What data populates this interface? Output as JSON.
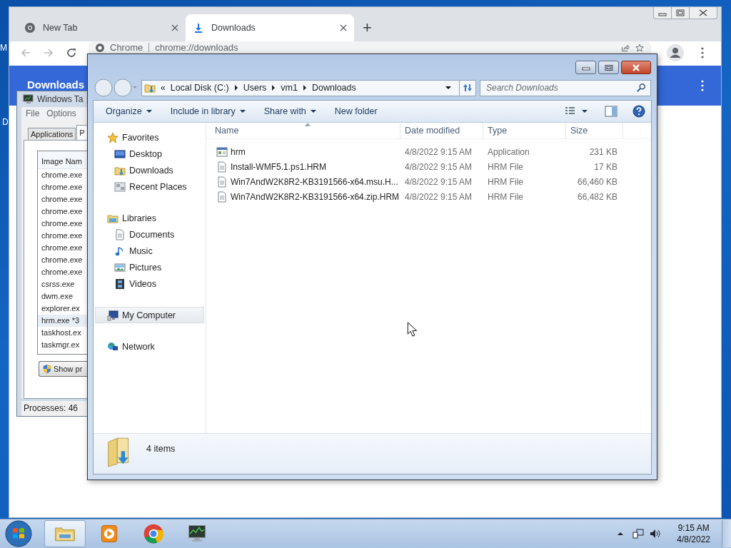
{
  "desktop": {
    "labels": [
      "M",
      "D"
    ]
  },
  "browser": {
    "tabs": [
      {
        "title": "New Tab",
        "selected": false
      },
      {
        "title": "Downloads",
        "selected": true
      }
    ],
    "new_tab": "+",
    "address": {
      "site": "Chrome",
      "url": "chrome://downloads"
    },
    "page": {
      "title": "Downloads"
    }
  },
  "task_manager": {
    "title": "Windows Ta",
    "menu": [
      "File",
      "Options"
    ],
    "tabs": [
      {
        "label": "Applications",
        "selected": false
      },
      {
        "label": "P",
        "selected": true
      }
    ],
    "column": "Image Nam",
    "rows": [
      {
        "name": "chrome.exe",
        "selected": false
      },
      {
        "name": "chrome.exe",
        "selected": false
      },
      {
        "name": "chrome.exe",
        "selected": false
      },
      {
        "name": "chrome.exe",
        "selected": false
      },
      {
        "name": "chrome.exe",
        "selected": false
      },
      {
        "name": "chrome.exe",
        "selected": false
      },
      {
        "name": "chrome.exe",
        "selected": false
      },
      {
        "name": "chrome.exe",
        "selected": false
      },
      {
        "name": "chrome.exe",
        "selected": false
      },
      {
        "name": "csrss.exe",
        "selected": false
      },
      {
        "name": "dwm.exe",
        "selected": false
      },
      {
        "name": "explorer.ex",
        "selected": false
      },
      {
        "name": "hrm.exe *3",
        "selected": true
      },
      {
        "name": "taskhost.ex",
        "selected": false
      },
      {
        "name": "taskmgr.ex",
        "selected": false
      }
    ],
    "button": "Show pr",
    "status": "Processes: 46"
  },
  "explorer": {
    "overflow_mark": "«",
    "breadcrumb": [
      "Local Disk (C:)",
      "Users",
      "vm1",
      "Downloads"
    ],
    "search": {
      "placeholder": "Search Downloads"
    },
    "toolbar": [
      {
        "label": "Organize",
        "dropdown": true
      },
      {
        "label": "Include in library",
        "dropdown": true
      },
      {
        "label": "Share with",
        "dropdown": true
      },
      {
        "label": "New folder",
        "dropdown": false
      }
    ],
    "nav": [
      {
        "label": "Favorites",
        "kind": "star",
        "selected": false,
        "children": [
          {
            "label": "Desktop",
            "kind": "desktop",
            "selected": false
          },
          {
            "label": "Downloads",
            "kind": "downloads",
            "selected": false
          },
          {
            "label": "Recent Places",
            "kind": "recent",
            "selected": false
          }
        ]
      },
      {
        "label": "Libraries",
        "kind": "library",
        "selected": false,
        "children": [
          {
            "label": "Documents",
            "kind": "document",
            "selected": false
          },
          {
            "label": "Music",
            "kind": "music",
            "selected": false
          },
          {
            "label": "Pictures",
            "kind": "pictures",
            "selected": false
          },
          {
            "label": "Videos",
            "kind": "video",
            "selected": false
          }
        ]
      },
      {
        "label": "My Computer",
        "kind": "computer",
        "selected": true
      },
      {
        "label": "Network",
        "kind": "network",
        "selected": false
      }
    ],
    "columns": [
      "Name",
      "Date modified",
      "Type",
      "Size"
    ],
    "files": [
      {
        "name": "hrm",
        "date": "4/8/2022 9:15 AM",
        "type": "Application",
        "size": "231 KB",
        "kind": "application"
      },
      {
        "name": "Install-WMF5.1.ps1.HRM",
        "date": "4/8/2022 9:15 AM",
        "type": "HRM File",
        "size": "17 KB",
        "kind": "document"
      },
      {
        "name": "Win7AndW2K8R2-KB3191566-x64.msu.H...",
        "date": "4/8/2022 9:15 AM",
        "type": "HRM File",
        "size": "66,460 KB",
        "kind": "document"
      },
      {
        "name": "Win7AndW2K8R2-KB3191566-x64.zip.HRM",
        "date": "4/8/2022 9:15 AM",
        "type": "HRM File",
        "size": "66,482 KB",
        "kind": "document"
      }
    ],
    "status": "4 items"
  },
  "taskbar": {
    "apps": [
      {
        "kind": "folder",
        "active": true
      },
      {
        "kind": "media",
        "active": false
      },
      {
        "kind": "chrome",
        "active": false
      },
      {
        "kind": "monitor",
        "active": false
      }
    ],
    "clock": {
      "time": "9:15 AM",
      "date": "4/8/2022"
    }
  }
}
